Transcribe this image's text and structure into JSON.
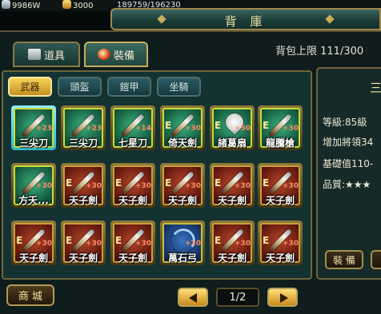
{
  "resources": {
    "silver": "9986W",
    "gold": "3000",
    "exp": "189759/196230"
  },
  "title": "背 庫",
  "category_tabs": [
    {
      "label": "道具",
      "active": false
    },
    {
      "label": "裝備",
      "active": true
    }
  ],
  "bag_limit": "背包上限  111/300",
  "sub_tabs": [
    {
      "label": "武器",
      "active": true
    },
    {
      "label": "頭盔",
      "active": false
    },
    {
      "label": "鎧甲",
      "active": false
    },
    {
      "label": "坐騎",
      "active": false
    }
  ],
  "items": [
    {
      "name": "三尖刀",
      "plus": "+23",
      "quality": "green",
      "weapon": "spear",
      "selected": true,
      "elvl": ""
    },
    {
      "name": "三尖刀",
      "plus": "+23",
      "quality": "green",
      "weapon": "spear",
      "selected": false,
      "elvl": ""
    },
    {
      "name": "七星刀",
      "plus": "+14",
      "quality": "green",
      "weapon": "blade",
      "selected": false,
      "elvl": ""
    },
    {
      "name": "倚天劍",
      "plus": "+30",
      "quality": "green",
      "weapon": "sword",
      "selected": false,
      "elvl": "E"
    },
    {
      "name": "諸葛扇",
      "plus": "+30",
      "quality": "green",
      "weapon": "fan",
      "selected": false,
      "elvl": "E"
    },
    {
      "name": "龍騰槍",
      "plus": "+30",
      "quality": "green",
      "weapon": "spear",
      "selected": false,
      "elvl": "E"
    },
    {
      "name": "方天...",
      "plus": "+30",
      "quality": "green",
      "weapon": "halberd",
      "selected": false,
      "elvl": ""
    },
    {
      "name": "天子劍",
      "plus": "+30",
      "quality": "red",
      "weapon": "sword",
      "selected": false,
      "elvl": "E"
    },
    {
      "name": "天子劍",
      "plus": "+30",
      "quality": "red",
      "weapon": "sword",
      "selected": false,
      "elvl": "E"
    },
    {
      "name": "天子劍",
      "plus": "+30",
      "quality": "red",
      "weapon": "sword",
      "selected": false,
      "elvl": "E"
    },
    {
      "name": "天子劍",
      "plus": "+30",
      "quality": "red",
      "weapon": "sword",
      "selected": false,
      "elvl": "E"
    },
    {
      "name": "天子劍",
      "plus": "+30",
      "quality": "red",
      "weapon": "sword",
      "selected": false,
      "elvl": "E"
    },
    {
      "name": "天子劍",
      "plus": "+30",
      "quality": "red",
      "weapon": "sword",
      "selected": false,
      "elvl": "E"
    },
    {
      "name": "天子劍",
      "plus": "+30",
      "quality": "red",
      "weapon": "sword",
      "selected": false,
      "elvl": "E"
    },
    {
      "name": "天子劍",
      "plus": "+30",
      "quality": "red",
      "weapon": "sword",
      "selected": false,
      "elvl": "E"
    },
    {
      "name": "萬石弓",
      "plus": "+20",
      "quality": "blue",
      "weapon": "bow",
      "selected": false,
      "elvl": ""
    },
    {
      "name": "天子劍",
      "plus": "+30",
      "quality": "red",
      "weapon": "sword",
      "selected": false,
      "elvl": "E"
    },
    {
      "name": "天子劍",
      "plus": "+30",
      "quality": "red",
      "weapon": "sword",
      "selected": false,
      "elvl": "E"
    }
  ],
  "detail": {
    "name": "三",
    "level": "等級:85級",
    "bonus": "增加將領34",
    "base": "基礎值110-",
    "quality": "品質:★★★"
  },
  "equip_button": "裝 備",
  "shop_button": "商 城",
  "pagination": "1/2"
}
